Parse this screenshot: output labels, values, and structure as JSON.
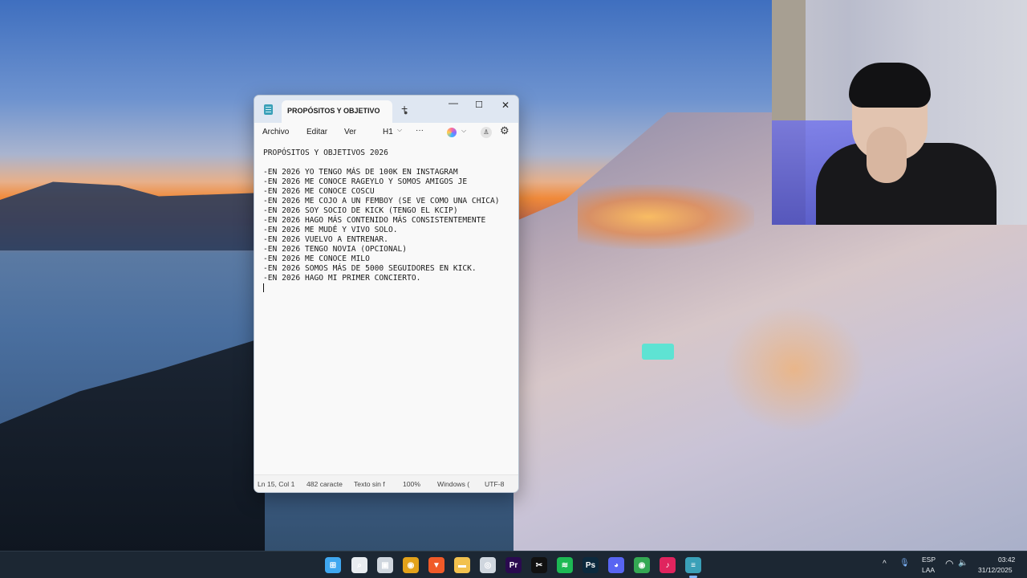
{
  "notepad": {
    "tab_title": "PROPÓSITOS Y OBJETIVO",
    "tab_unsaved_marker": "●",
    "new_tab": "+",
    "window_controls": {
      "minimize": "—",
      "maximize": "☐",
      "close": "✕"
    },
    "menu": {
      "file": "Archivo",
      "edit": "Editar",
      "view": "Ver",
      "heading": "H1",
      "heading_chevron": "⌵",
      "more": "···"
    },
    "toolbar_icons": [
      "copilot-icon",
      "account-icon",
      "gear-icon"
    ],
    "lines": [
      "PROPÓSITOS Y OBJETIVOS 2026",
      "",
      "-EN 2026 YO TENGO MÁS DE 100K EN INSTAGRAM",
      "-EN 2026 ME CONOCE RAGEYLO Y SOMOS AMIGOS JE",
      "-EN 2026 ME CONOCE COSCU",
      "-EN 2026 ME COJO A UN FEMBOY (SE VE COMO UNA CHICA)",
      "-EN 2026 SOY SOCIO DE KICK (TENGO EL KCIP)",
      "-EN 2026 HAGO MÁS CONTENIDO MÁS CONSISTENTEMENTE",
      "-EN 2026 ME MUDÉ Y VIVO SOLO.",
      "-EN 2026 VUELVO A ENTRENAR.",
      "-EN 2026 TENGO NOVIA (OPCIONAL)",
      "-EN 2026 ME CONOCE MILO",
      "-EN 2026 SOMOS MÁS DE 5000 SEGUIDORES EN KICK.",
      "-EN 2026 HAGO MI PRIMER CONCIERTO.",
      ""
    ],
    "status": {
      "position": "Ln 15, Col 1",
      "chars": "482 caracte",
      "format": "Texto sin f",
      "zoom": "100%",
      "line_ending": "Windows (",
      "encoding": "UTF-8"
    }
  },
  "taskbar": {
    "apps": [
      {
        "name": "start-icon",
        "glyph": "⊞",
        "color": "#3fa7f0"
      },
      {
        "name": "search-icon",
        "glyph": "⌕",
        "color": "#e8ecf0"
      },
      {
        "name": "task-view-icon",
        "glyph": "▣",
        "color": "#cfd6de"
      },
      {
        "name": "chrome-icon",
        "glyph": "◉",
        "color": "#e3a21a"
      },
      {
        "name": "brave-icon",
        "glyph": "▼",
        "color": "#f05a28"
      },
      {
        "name": "file-explorer-icon",
        "glyph": "▬",
        "color": "#f2c14e"
      },
      {
        "name": "obs-icon",
        "glyph": "◎",
        "color": "#cfd6de"
      },
      {
        "name": "premiere-icon",
        "glyph": "Pr",
        "color": "#2a0a4f"
      },
      {
        "name": "capcut-icon",
        "glyph": "✂",
        "color": "#111111"
      },
      {
        "name": "spotify-icon",
        "glyph": "≋",
        "color": "#1db954"
      },
      {
        "name": "photoshop-icon",
        "glyph": "Ps",
        "color": "#0c2a3e"
      },
      {
        "name": "discord-icon",
        "glyph": "◕",
        "color": "#5865f2"
      },
      {
        "name": "chrome-2-icon",
        "glyph": "◉",
        "color": "#34a853"
      },
      {
        "name": "tiktok-icon",
        "glyph": "♪",
        "color": "#e0245e"
      },
      {
        "name": "notepad-icon",
        "glyph": "≡",
        "color": "#3aa0b8"
      }
    ],
    "tray": {
      "chevron": "^",
      "mic": "🎙",
      "lang_top": "ESP",
      "lang_bottom": "LAA",
      "wifi": "◠",
      "volume": "🔈",
      "time": "03:42",
      "date": "31/12/2025"
    }
  }
}
